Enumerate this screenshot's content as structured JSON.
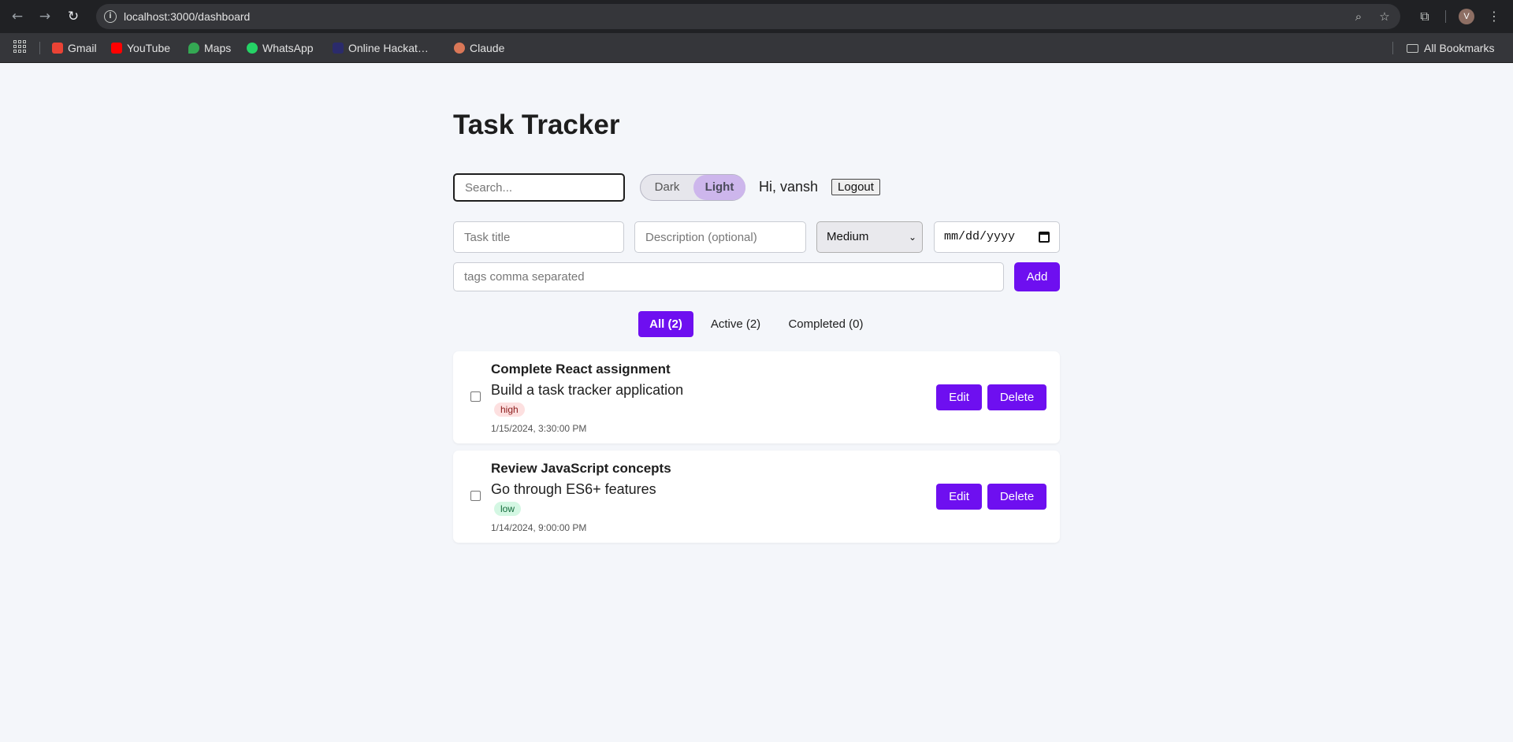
{
  "browser": {
    "url": "localhost:3000/dashboard",
    "icons": [
      "back-icon",
      "forward-icon",
      "reload-icon",
      "site-info-icon",
      "zoom-icon",
      "star-icon",
      "extensions-icon",
      "profile-avatar",
      "menu-icon"
    ],
    "avatar_initial": "V",
    "bookmarks": [
      {
        "label": "Gmail",
        "color": "#ea4335"
      },
      {
        "label": "YouTube",
        "color": "#ff0000"
      },
      {
        "label": "Maps",
        "color": "#34a853"
      },
      {
        "label": "WhatsApp",
        "color": "#25d366"
      },
      {
        "label": "Online Hackat…",
        "color": "#2b2b6b"
      },
      {
        "label": "Claude",
        "color": "#d97757"
      }
    ],
    "all_bookmarks_label": "All Bookmarks"
  },
  "app": {
    "title": "Task Tracker",
    "search_placeholder": "Search...",
    "theme": {
      "dark_label": "Dark",
      "light_label": "Light",
      "selected": "Light"
    },
    "greeting": "Hi, vansh",
    "logout_label": "Logout",
    "accent_color": "#6e0ff0"
  },
  "form": {
    "title_placeholder": "Task title",
    "description_placeholder": "Description (optional)",
    "priority_value": "Medium",
    "date_placeholder": "mm/dd/yyyy",
    "tags_placeholder": "tags comma separated",
    "add_label": "Add"
  },
  "filters": [
    {
      "label": "All (2)",
      "active": true
    },
    {
      "label": "Active (2)",
      "active": false
    },
    {
      "label": "Completed (0)",
      "active": false
    }
  ],
  "tasks": [
    {
      "title": "Complete React assignment",
      "description": "Build a task tracker application",
      "priority": "high",
      "date": "1/15/2024, 3:30:00 PM",
      "completed": false,
      "edit_label": "Edit",
      "delete_label": "Delete"
    },
    {
      "title": "Review JavaScript concepts",
      "description": "Go through ES6+ features",
      "priority": "low",
      "date": "1/14/2024, 9:00:00 PM",
      "completed": false,
      "edit_label": "Edit",
      "delete_label": "Delete"
    }
  ]
}
